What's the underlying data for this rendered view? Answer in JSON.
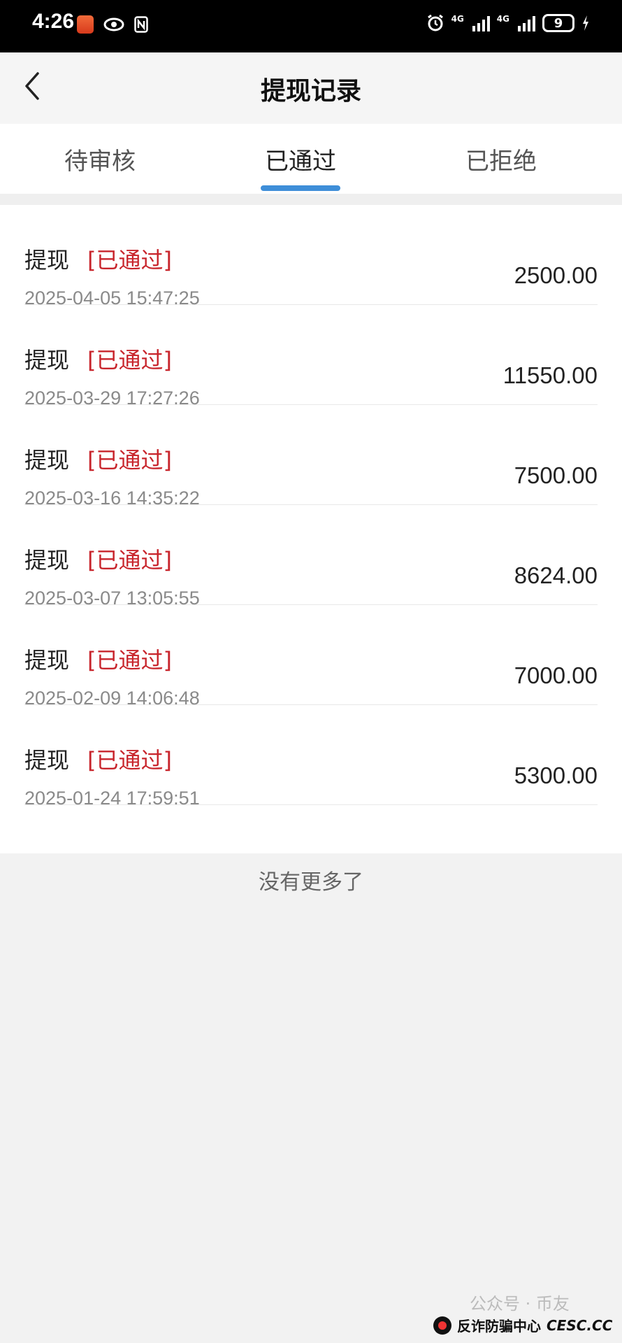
{
  "status_bar": {
    "time": "4:26",
    "battery": "9",
    "network": [
      "4G",
      "4G"
    ],
    "icons": [
      "app-badge-icon",
      "eye-icon",
      "nfc-icon",
      "alarm-icon",
      "signal-icon",
      "battery-icon",
      "charging-icon"
    ]
  },
  "nav": {
    "title": "提现记录",
    "back_icon": "chevron-left-icon"
  },
  "tabs": [
    {
      "label": "待审核",
      "active": false
    },
    {
      "label": "已通过",
      "active": true
    },
    {
      "label": "已拒绝",
      "active": false
    }
  ],
  "accent_color": "#3e8ed8",
  "status_color": "#c8252c",
  "records": [
    {
      "type": "提现",
      "status": "[已通过]",
      "time": "2025-04-05 15:47:25",
      "amount": "2500.00"
    },
    {
      "type": "提现",
      "status": "[已通过]",
      "time": "2025-03-29 17:27:26",
      "amount": "11550.00"
    },
    {
      "type": "提现",
      "status": "[已通过]",
      "time": "2025-03-16 14:35:22",
      "amount": "7500.00"
    },
    {
      "type": "提现",
      "status": "[已通过]",
      "time": "2025-03-07 13:05:55",
      "amount": "8624.00"
    },
    {
      "type": "提现",
      "status": "[已通过]",
      "time": "2025-02-09 14:06:48",
      "amount": "7000.00"
    },
    {
      "type": "提现",
      "status": "[已通过]",
      "time": "2025-01-24 17:59:51",
      "amount": "5300.00"
    }
  ],
  "footer": "没有更多了",
  "watermark": {
    "top": "公众号 · 币友",
    "label": "反诈防骗中心",
    "site": "CESC.CC"
  }
}
